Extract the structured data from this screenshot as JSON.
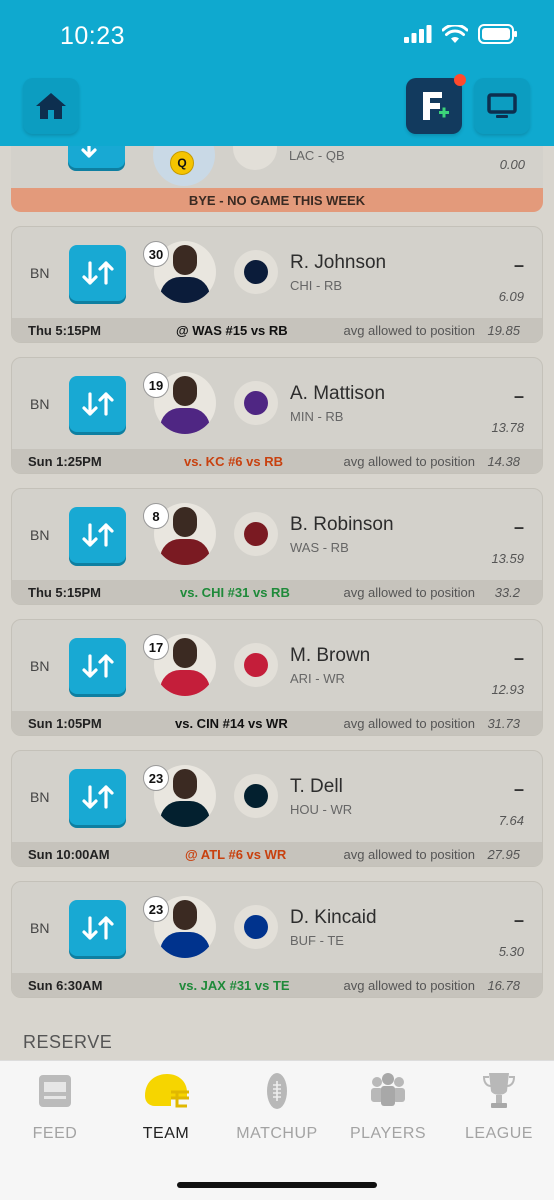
{
  "status_bar": {
    "time": "10:23"
  },
  "partial_card": {
    "team_pos": "LAC - QB",
    "points": "0.00",
    "status_badge": "Q",
    "bye_text": "BYE - NO GAME THIS WEEK"
  },
  "players": [
    {
      "slot": "BN",
      "jersey": "30",
      "name": "R. Johnson",
      "team_pos": "CHI - RB",
      "dash": "–",
      "points": "6.09",
      "game_time": "Thu 5:15PM",
      "opponent": "@ WAS #15 vs RB",
      "opponent_color": "#111111",
      "avg_label": "avg allowed to position",
      "avg_value": "19.85",
      "team_color": "#0b1c3a"
    },
    {
      "slot": "BN",
      "jersey": "19",
      "name": "A. Mattison",
      "team_pos": "MIN - RB",
      "dash": "–",
      "points": "13.78",
      "game_time": "Sun 1:25PM",
      "opponent": "vs. KC #6 vs RB",
      "opponent_color": "#c8410f",
      "avg_label": "avg allowed to position",
      "avg_value": "14.38",
      "team_color": "#4f2683"
    },
    {
      "slot": "BN",
      "jersey": "8",
      "name": "B. Robinson",
      "team_pos": "WAS - RB",
      "dash": "–",
      "points": "13.59",
      "game_time": "Thu 5:15PM",
      "opponent": "vs. CHI #31 vs RB",
      "opponent_color": "#1f8a3a",
      "avg_label": "avg allowed to position",
      "avg_value": "33.2",
      "team_color": "#7a1a22"
    },
    {
      "slot": "BN",
      "jersey": "17",
      "name": "M. Brown",
      "team_pos": "ARI - WR",
      "dash": "–",
      "points": "12.93",
      "game_time": "Sun 1:05PM",
      "opponent": "vs. CIN #14 vs WR",
      "opponent_color": "#111111",
      "avg_label": "avg allowed to position",
      "avg_value": "31.73",
      "team_color": "#c41e3a"
    },
    {
      "slot": "BN",
      "jersey": "23",
      "name": "T. Dell",
      "team_pos": "HOU - WR",
      "dash": "–",
      "points": "7.64",
      "game_time": "Sun 10:00AM",
      "opponent": "@ ATL #6 vs WR",
      "opponent_color": "#c8410f",
      "avg_label": "avg allowed to position",
      "avg_value": "27.95",
      "team_color": "#03202f"
    },
    {
      "slot": "BN",
      "jersey": "23",
      "name": "D. Kincaid",
      "team_pos": "BUF - TE",
      "dash": "–",
      "points": "5.30",
      "game_time": "Sun 6:30AM",
      "opponent": "vs. JAX #31 vs TE",
      "opponent_color": "#1f8a3a",
      "avg_label": "avg allowed to position",
      "avg_value": "16.78",
      "team_color": "#00338d"
    }
  ],
  "section_reserve": "RESERVE",
  "tabs": [
    {
      "label": "FEED",
      "icon": "feed-icon"
    },
    {
      "label": "TEAM",
      "icon": "helmet-icon",
      "active": true
    },
    {
      "label": "MATCHUP",
      "icon": "football-icon"
    },
    {
      "label": "PLAYERS",
      "icon": "players-icon"
    },
    {
      "label": "LEAGUE",
      "icon": "trophy-icon"
    }
  ]
}
